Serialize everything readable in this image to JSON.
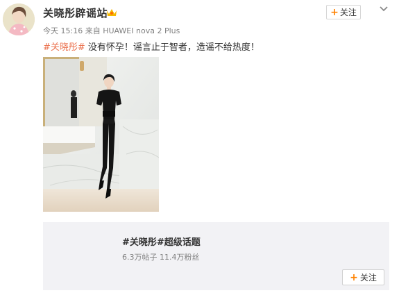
{
  "post": {
    "username": "关晓彤辟谣站",
    "meta": "今天 15:16 来自 HUAWEI nova 2 Plus",
    "follow_label": "关注",
    "hashtag": "#关晓彤#",
    "text": " 没有怀孕！谣言止于智者，造谣不给热度！"
  },
  "topic": {
    "title": "#关晓彤#超级话题",
    "stats": "6.3万帖子 11.4万粉丝",
    "follow_label": "关注"
  },
  "colors": {
    "accent": "#ff8200",
    "hashtag": "#eb7350",
    "card_bg": "#f2f2f5"
  },
  "icons": {
    "badge": "vip-badge-icon",
    "menu": "chevron-down-icon",
    "plus": "plus-icon"
  }
}
